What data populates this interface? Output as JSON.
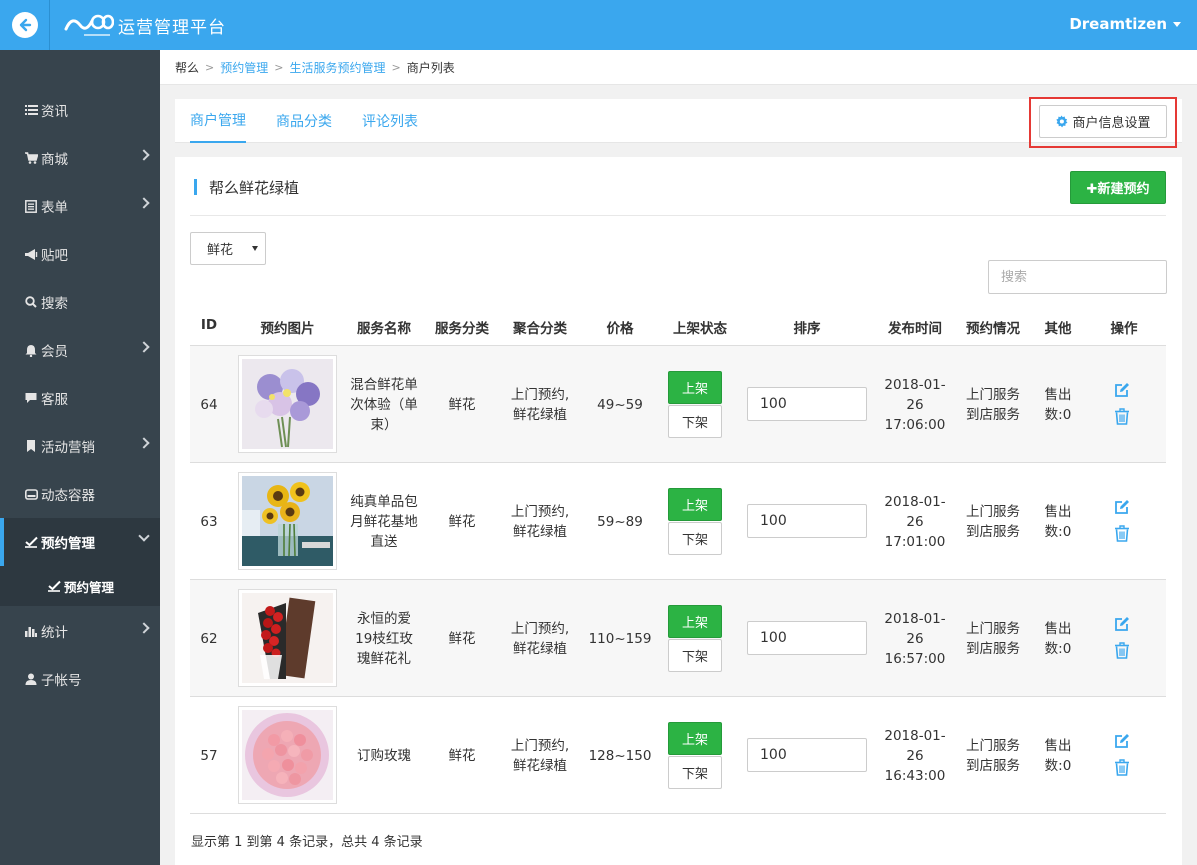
{
  "header": {
    "platform_title": "运营管理平台",
    "user_name": "Dreamtizen",
    "accent_color": "#3aa7ee"
  },
  "sidebar": {
    "items": [
      {
        "label": "资讯",
        "icon": "list-icon"
      },
      {
        "label": "商城",
        "icon": "cart-icon"
      },
      {
        "label": "表单",
        "icon": "form-icon"
      },
      {
        "label": "贴吧",
        "icon": "megaphone-icon"
      },
      {
        "label": "搜索",
        "icon": "search-icon"
      },
      {
        "label": "会员",
        "icon": "bell-icon"
      },
      {
        "label": "客服",
        "icon": "chat-icon"
      },
      {
        "label": "活动营销",
        "icon": "bookmark-icon"
      },
      {
        "label": "动态容器",
        "icon": "hdd-icon"
      },
      {
        "label": "预约管理",
        "icon": "check-square-icon"
      },
      {
        "label": "统计",
        "icon": "bar-chart-icon"
      },
      {
        "label": "子帐号",
        "icon": "user-icon"
      }
    ],
    "sub_item": "预约管理"
  },
  "breadcrumb": {
    "items": [
      "帮么",
      "预约管理",
      "生活服务预约管理",
      "商户列表"
    ]
  },
  "tabs": [
    "商户管理",
    "商品分类",
    "评论列表"
  ],
  "settings_button": "商户信息设置",
  "section": {
    "title": "帮么鲜花绿植",
    "new_button": "✚新建预约"
  },
  "filter": {
    "category_value": "鲜花",
    "search_placeholder": "搜索"
  },
  "table": {
    "headers": [
      "ID",
      "预约图片",
      "服务名称",
      "服务分类",
      "聚合分类",
      "价格",
      "上架状态",
      "排序",
      "发布时间",
      "预约情况",
      "其他",
      "操作"
    ],
    "rows": [
      {
        "id": "64",
        "name": "混合鲜花单次体验（单束）",
        "category": "鲜花",
        "aggregate": "上门预约,鲜花绿植",
        "price": "49~59",
        "up_label": "上架",
        "down_label": "下架",
        "sort": "100",
        "publish_time": "2018-01-26 17:06:00",
        "booking": "上门服务 到店服务",
        "other": "售出数:0"
      },
      {
        "id": "63",
        "name": "纯真单品包月鲜花基地直送",
        "category": "鲜花",
        "aggregate": "上门预约,鲜花绿植",
        "price": "59~89",
        "up_label": "上架",
        "down_label": "下架",
        "sort": "100",
        "publish_time": "2018-01-26 17:01:00",
        "booking": "上门服务 到店服务",
        "other": "售出数:0"
      },
      {
        "id": "62",
        "name": "永恒的爱19枝红玫瑰鲜花礼",
        "category": "鲜花",
        "aggregate": "上门预约,鲜花绿植",
        "price": "110~159",
        "up_label": "上架",
        "down_label": "下架",
        "sort": "100",
        "publish_time": "2018-01-26 16:57:00",
        "booking": "上门服务 到店服务",
        "other": "售出数:0"
      },
      {
        "id": "57",
        "name": "订购玫瑰",
        "category": "鲜花",
        "aggregate": "上门预约,鲜花绿植",
        "price": "128~150",
        "up_label": "上架",
        "down_label": "下架",
        "sort": "100",
        "publish_time": "2018-01-26 16:43:00",
        "booking": "上门服务 到店服务",
        "other": "售出数:0"
      }
    ]
  },
  "footer": "显示第 1 到第 4 条记录，总共 4 条记录"
}
